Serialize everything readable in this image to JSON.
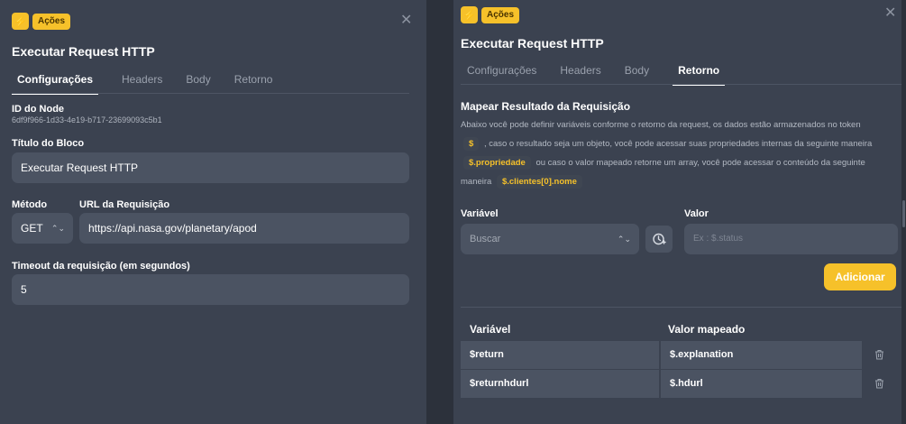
{
  "left": {
    "badge": "Ações",
    "title": "Executar Request HTTP",
    "tabs": [
      "Configurações",
      "Headers",
      "Body",
      "Retorno"
    ],
    "node_id_label": "ID do Node",
    "node_id_value": "6df9f966-1d33-4e19-b717-23699093c5b1",
    "block_title_label": "Título do Bloco",
    "block_title_value": "Executar Request HTTP",
    "method_label": "Método",
    "method_value": "GET",
    "url_label": "URL da Requisição",
    "url_value": "https://api.nasa.gov/planetary/apod",
    "timeout_label": "Timeout da requisição (em segundos)",
    "timeout_value": "5"
  },
  "right": {
    "badge": "Ações",
    "title": "Executar Request HTTP",
    "tabs": [
      "Configurações",
      "Headers",
      "Body",
      "Retorno"
    ],
    "section_title": "Mapear Resultado da Requisição",
    "desc": {
      "p1": "Abaixo você pode definir variáveis conforme o retorno da request, os dados estão armazenados no token",
      "code1": "$",
      "p2": ", caso o resultado seja um objeto, você pode acessar suas propriedades internas da seguinte maneira",
      "code2": "$.propriedade",
      "p3": "ou caso o valor mapeado retorne um array, você pode acessar o conteúdo da seguinte maneira",
      "code3": "$.clientes[0].nome"
    },
    "variable_label": "Variável",
    "variable_placeholder": "Buscar",
    "value_label": "Valor",
    "value_placeholder": "Ex : $.status",
    "add_button": "Adicionar",
    "table": {
      "headers": [
        "Variável",
        "Valor mapeado"
      ],
      "rows": [
        {
          "variable": "$return",
          "value": "$.explanation"
        },
        {
          "variable": "$returnhdurl",
          "value": "$.hdurl"
        }
      ]
    }
  },
  "colors": {
    "accent": "#f6c12a",
    "panel": "#3b4250",
    "field": "#4b5362"
  }
}
